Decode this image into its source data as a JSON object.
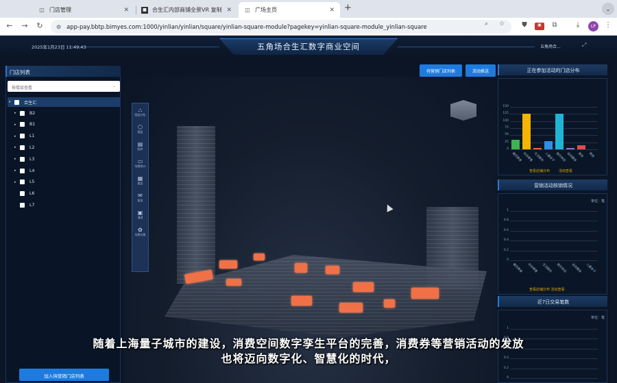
{
  "browser": {
    "tabs": [
      {
        "title": "门店管理",
        "icon": "page-icon"
      },
      {
        "title": "合生汇内部商铺全景VR 复制",
        "icon": "app-icon"
      },
      {
        "title": "广场主页",
        "icon": "page-icon"
      }
    ],
    "new_tab": "+",
    "url": "app-pay.bbtp.bimyes.com:1000/yinlian/yinlian/square/yinlian-square-module?pagekey=yinlian-square-module_yinlian-square",
    "profile_initials": "LP"
  },
  "header": {
    "datetime": "2025年1月23日 11:49:43",
    "title": "五角场合生汇数字商业空间",
    "weather": "五角场合..."
  },
  "store_panel": {
    "title": "门店列表",
    "select_placeholder": "按楼层查看",
    "root_label": "合生汇",
    "floors": [
      "B2",
      "B1",
      "L1",
      "L2",
      "L3",
      "L4",
      "L5",
      "L6",
      "L7"
    ],
    "bottom_button": "加入待营销门店列表"
  },
  "top_buttons": {
    "pending_list": "待营销门店列表",
    "push_activity": "活动推送"
  },
  "toolbar": {
    "items": [
      {
        "icon": "tree-icon",
        "label": "图层分析"
      },
      {
        "icon": "cube-icon",
        "label": "楼层"
      },
      {
        "icon": "doc-icon",
        "label": "图库"
      },
      {
        "icon": "chat-icon",
        "label": "场景统计"
      },
      {
        "icon": "grid-icon",
        "label": "楼层"
      },
      {
        "icon": "message-icon",
        "label": "客流"
      },
      {
        "icon": "box-icon",
        "label": "漫游"
      },
      {
        "icon": "flower-icon",
        "label": "场景切换"
      }
    ]
  },
  "right_panel": {
    "activity_title": "正在参加活动的门店分布",
    "activity_link_left": "查看店铺分布",
    "activity_link_right": "活动查看",
    "sales_title": "营销活动核销情况",
    "sales_unit": "单位：笔",
    "sales_links": "查看店铺分布  活动查看",
    "trade_title": "近7日交易笔数",
    "trade_unit": "单位：笔"
  },
  "chart_data": [
    {
      "type": "bar",
      "categories": [
        "餐饮美食",
        "时尚零售",
        "生活服务",
        "儿童亲子",
        "娱乐休闲",
        "运动健身",
        "其他",
        "其他"
      ],
      "values": [
        35,
        125,
        6,
        30,
        125,
        5,
        15,
        0
      ],
      "colors": [
        "#3fb34f",
        "#f4b400",
        "#e8673a",
        "#2f8fe6",
        "#1fb4d4",
        "#8f6fd8",
        "#e04b4b",
        "#999999"
      ],
      "ylim": [
        0,
        150
      ],
      "yticks": [
        0,
        25,
        50,
        75,
        100,
        125,
        150
      ]
    },
    {
      "type": "bar",
      "categories": [
        "餐饮美食",
        "时尚零售",
        "生活服务",
        "娱乐休闲",
        "运动健身",
        "儿童亲子"
      ],
      "values": [
        0,
        0,
        0,
        0,
        0,
        0
      ],
      "ylim": [
        0,
        1
      ],
      "yticks": [
        0,
        0.2,
        0.4,
        0.6,
        0.8,
        1
      ]
    },
    {
      "type": "line",
      "ylim": [
        0,
        1
      ],
      "yticks": [
        0,
        0.2,
        0.4,
        0.6,
        0.8,
        1
      ]
    }
  ],
  "subtitles": {
    "line1": "随着上海量子城市的建设，消费空间数字孪生平台的完善，消费券等营销活动的发放",
    "line2": "也将迈向数字化、智慧化的时代，"
  }
}
